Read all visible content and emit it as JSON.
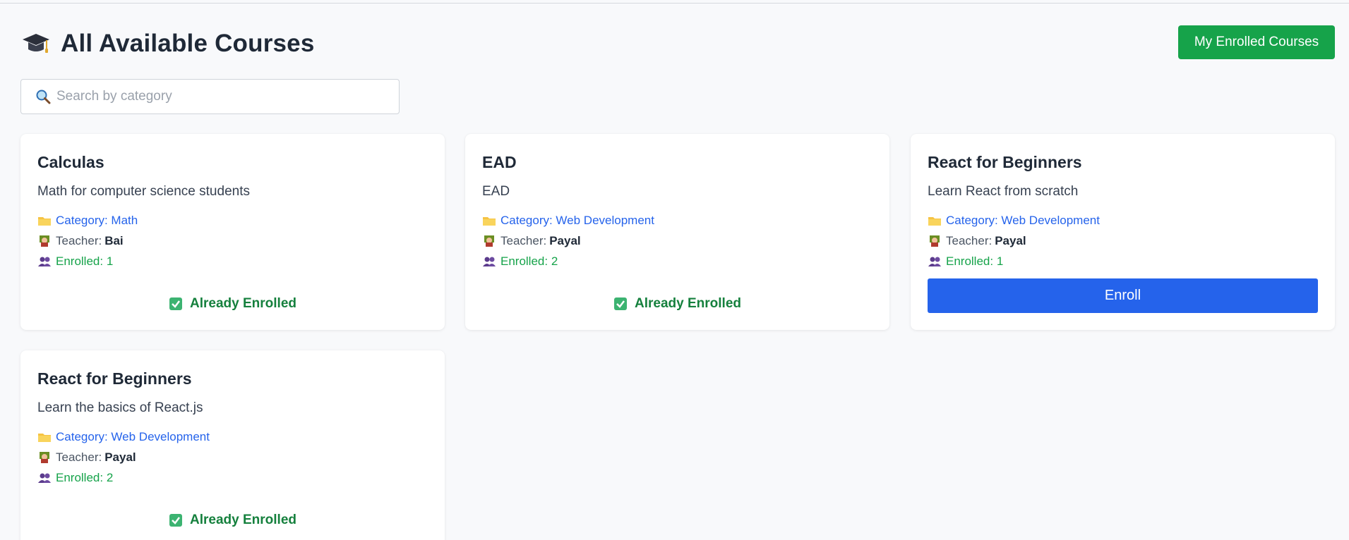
{
  "page": {
    "title": "All Available Courses",
    "title_icon": "graduation-cap-icon",
    "my_enrolled_label": "My Enrolled Courses",
    "accent_green": "#16a34a",
    "accent_blue": "#2563eb"
  },
  "search": {
    "placeholder": "Search by category",
    "value": "",
    "icon": "magnifier-icon"
  },
  "courses": [
    {
      "title": "Calculas",
      "description": "Math for computer science students",
      "category": "Category: Math",
      "teacher_label": "Teacher:",
      "teacher": "Bai",
      "enrolled": "Enrolled: 1",
      "status": "Already Enrolled"
    },
    {
      "title": "EAD",
      "description": "EAD",
      "category": "Category: Web Development",
      "teacher_label": "Teacher:",
      "teacher": "Payal",
      "enrolled": "Enrolled: 2",
      "status": "Already Enrolled"
    },
    {
      "title": "React for Beginners",
      "description": "Learn React from scratch",
      "category": "Category: Web Development",
      "teacher_label": "Teacher:",
      "teacher": "Payal",
      "enrolled": "Enrolled: 1",
      "action_label": "Enroll"
    },
    {
      "title": "React for Beginners",
      "description": "Learn the basics of React.js",
      "category": "Category: Web Development",
      "teacher_label": "Teacher:",
      "teacher": "Payal",
      "enrolled": "Enrolled: 2",
      "status": "Already Enrolled"
    }
  ]
}
